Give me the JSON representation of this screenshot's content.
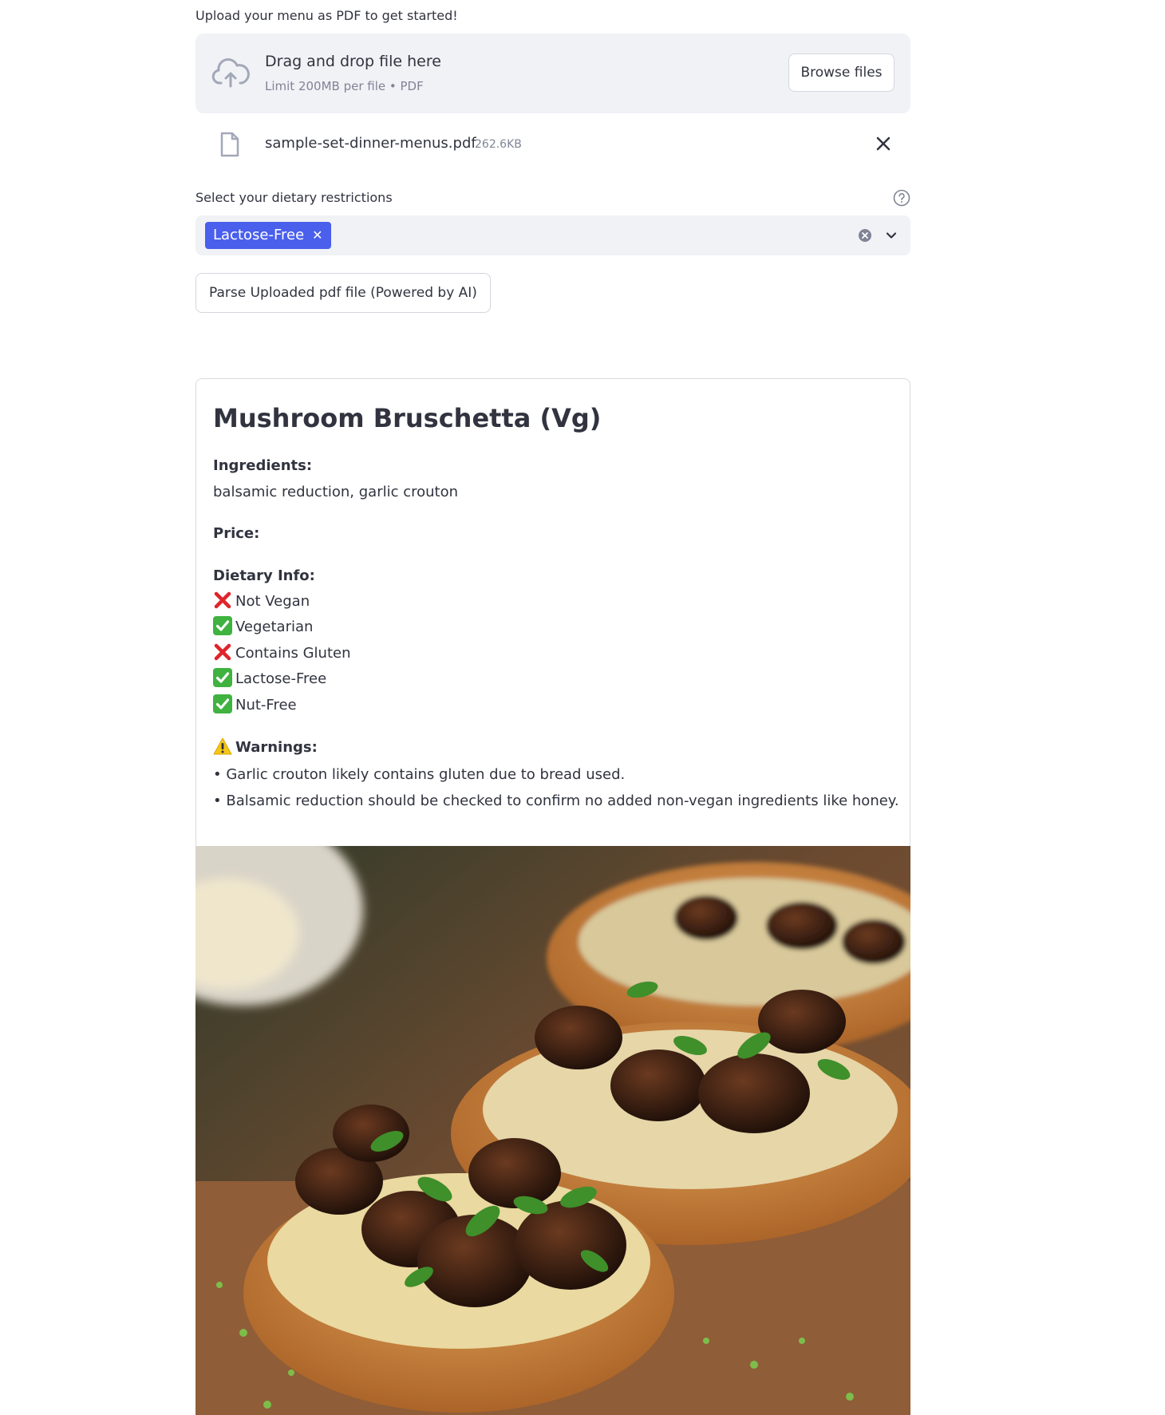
{
  "uploader": {
    "label": "Upload your menu as PDF to get started!",
    "drop_title": "Drag and drop file here",
    "drop_sub": "Limit 200MB per file • PDF",
    "browse_label": "Browse files"
  },
  "file": {
    "name": "sample-set-dinner-menus.pdf",
    "size": "262.6KB"
  },
  "diet": {
    "label": "Select your dietary restrictions",
    "selected": [
      "Lactose-Free"
    ]
  },
  "parse_button": "Parse Uploaded pdf file (Powered by AI)",
  "dish": {
    "title": "Mushroom Bruschetta (Vg)",
    "ingredients_label": "Ingredients:",
    "ingredients": "balsamic reduction, garlic crouton",
    "price_label": "Price:",
    "dietary_label": "Dietary Info:",
    "dietary": [
      {
        "mark": "cross",
        "text": "Not Vegan"
      },
      {
        "mark": "check",
        "text": "Vegetarian"
      },
      {
        "mark": "cross",
        "text": "Contains Gluten"
      },
      {
        "mark": "check",
        "text": "Lactose-Free"
      },
      {
        "mark": "check",
        "text": "Nut-Free"
      }
    ],
    "warnings_label": "Warnings:",
    "warnings": [
      "• Garlic crouton likely contains gluten due to bread used.",
      "• Balsamic reduction should be checked to confirm no added non-vegan ingredients like honey."
    ]
  },
  "icons": {
    "upload": "cloud-upload-icon",
    "file": "file-icon",
    "close": "close-icon",
    "help": "help-circle-icon",
    "clear": "clear-icon",
    "chevron": "chevron-down-icon",
    "check": "check-icon",
    "cross": "cross-icon",
    "warning": "warning-icon"
  },
  "colors": {
    "accent": "#4a5fec",
    "panel": "#f0f2f6",
    "text": "#31333f",
    "muted": "#808495",
    "check": "#3fb23f",
    "cross": "#e0242b",
    "warning": "#f5c518"
  }
}
